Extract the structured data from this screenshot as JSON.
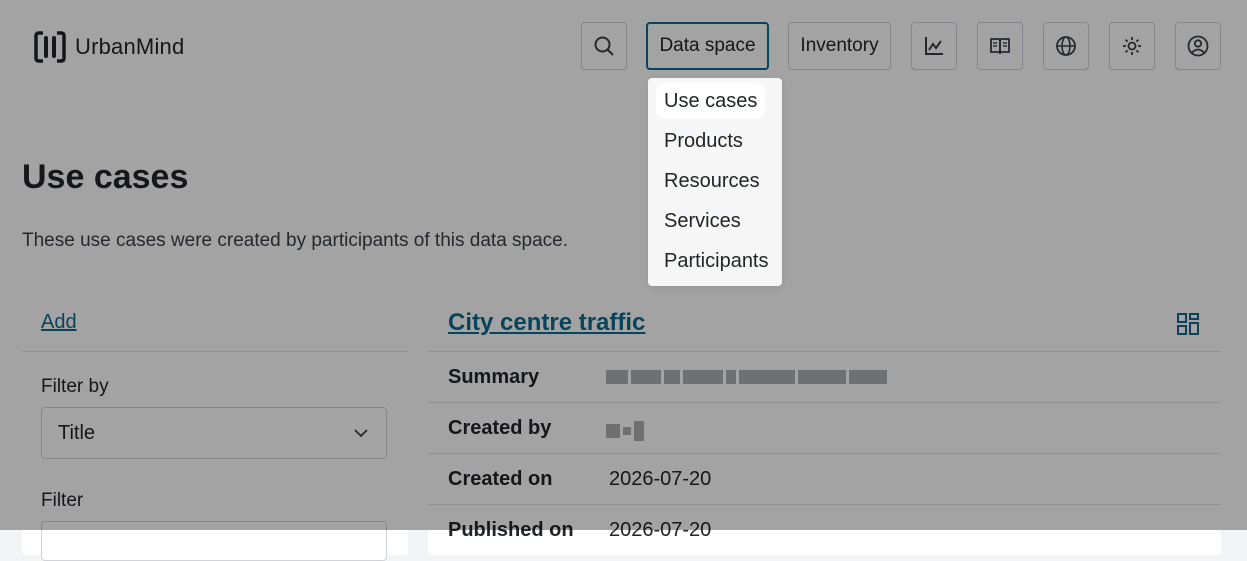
{
  "app": {
    "name": "UrbanMind"
  },
  "header": {
    "search_icon": "search-icon",
    "data_space_label": "Data space",
    "inventory_label": "Inventory",
    "icons": [
      "chart-icon",
      "book-icon",
      "globe-icon",
      "brightness-icon",
      "account-icon"
    ]
  },
  "dropdown": {
    "items": [
      {
        "label": "Use cases",
        "highlighted": true
      },
      {
        "label": "Products"
      },
      {
        "label": "Resources"
      },
      {
        "label": "Services"
      },
      {
        "label": "Participants"
      }
    ]
  },
  "page": {
    "title": "Use cases",
    "description": "These use cases were created by participants of this data space."
  },
  "filters": {
    "add_label": "Add",
    "filter_by_label": "Filter by",
    "filter_by_value": "Title",
    "filter_label": "Filter"
  },
  "card": {
    "title": "City centre traffic",
    "rows": [
      {
        "key": "Summary",
        "value": ""
      },
      {
        "key": "Created by",
        "value": ""
      },
      {
        "key": "Created on",
        "value": "2026-07-20"
      },
      {
        "key": "Published on",
        "value": "2026-07-20"
      }
    ]
  },
  "colors": {
    "accent": "#0d6b8f",
    "overlay": "rgba(0,0,0,0.36)"
  }
}
